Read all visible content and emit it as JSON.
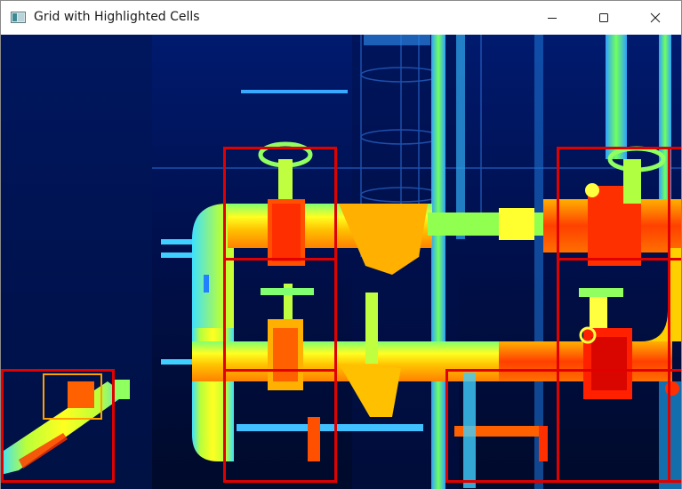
{
  "window": {
    "title": "Grid with Highlighted Cells"
  },
  "titlebar_buttons": {
    "minimize": "minimize",
    "maximize": "maximize",
    "close": "close"
  },
  "highlight_color": "#e00000",
  "highlighted_cells": [
    {
      "col": 2,
      "row": 1
    },
    {
      "col": 5,
      "row": 1
    },
    {
      "col": 6,
      "row": 1
    },
    {
      "col": 2,
      "row": 2
    },
    {
      "col": 5,
      "row": 2
    },
    {
      "col": 0,
      "row": 3
    },
    {
      "col": 2,
      "row": 3
    },
    {
      "col": 4,
      "row": 3
    },
    {
      "col": 5,
      "row": 3
    },
    {
      "col": 6,
      "row": 3
    }
  ],
  "image": {
    "kind": "thermal-image",
    "subject": "industrial pipes and valves",
    "palette": "jet"
  }
}
